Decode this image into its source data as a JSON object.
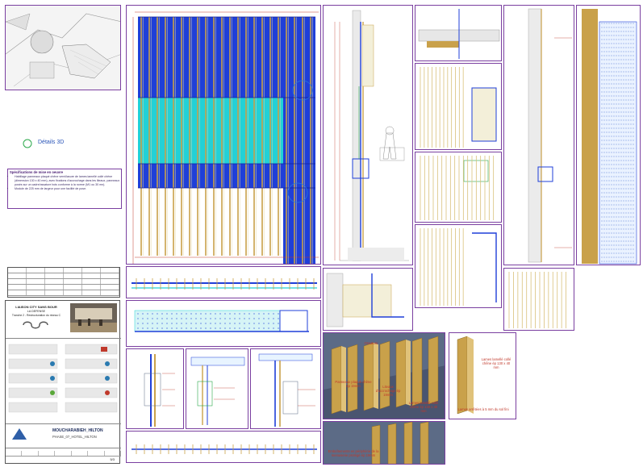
{
  "detail_link": {
    "label": "Détails 3D",
    "circle_color": "#2aa84a"
  },
  "specs": {
    "title": "Spécifications de mise en oeuvre",
    "items": [
      "Habillage panneaux plaqué chêne verni/lasure de lames lamellé collé chêne (dimension 130 x 40 mm), avec fixations d'accrochage dans les liteaux, panneaux posés sur un cadre/ossature bois conforme à la norme (M1 ou 30 mn).",
      "Module de 225 mm de largeur pour une facilité de pose."
    ]
  },
  "titleblock": {
    "project_line1": "LIAISON CITY SANS BOUR",
    "project_line2": "LA DEFENSE",
    "project_line3": "Tranche 2 - Restructuration du niveau C",
    "sheet_name": "MOUCHARABIEH_HILTON",
    "sheet_code": "PHASE_07_HOTEL_HILTON",
    "footer_code": "5/3"
  },
  "callouts": {
    "plaque": "Panneaux plaqué chêne ép 19mm",
    "liteaux": "Liteaux d'accrochage ép 19mm",
    "lames": "Lames lamellé collé chêne ép 130 x 40 mm",
    "closure": "Ossature",
    "board_main": "Lames lamellé collé chêne ép 130 x 40 mm",
    "board_foot": "Lames arrêtées à 5 mm du sol fini",
    "bottom": "Emboîtements en périphérie de la menuiserie protégé ép 19mm"
  },
  "colors": {
    "frame": "#7a3fa0",
    "blue": "#1f3fd8",
    "cyan": "#23d1d6",
    "wood": "#c9a14a",
    "red": "#c0392b",
    "slate": "#5c6b86"
  }
}
